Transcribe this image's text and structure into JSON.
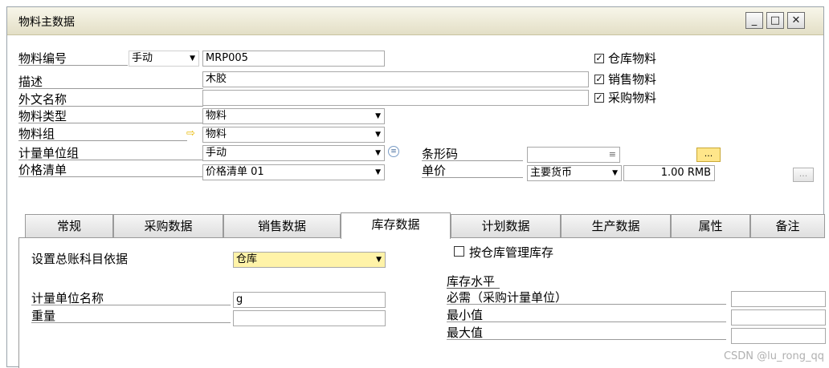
{
  "window": {
    "title": "物料主数据",
    "controls": {
      "minimize": "_",
      "maximize": "□",
      "close": "✕"
    }
  },
  "header": {
    "item_code_label": "物料编号",
    "item_code_mode": "手动",
    "item_code_value": "MRP005",
    "description_label": "描述",
    "description_value": "木胶",
    "foreign_name_label": "外文名称",
    "foreign_name_value": "",
    "item_type_label": "物料类型",
    "item_type_value": "物料",
    "item_group_label": "物料组",
    "item_group_value": "物料",
    "uom_group_label": "计量单位组",
    "uom_group_value": "手动",
    "price_list_label": "价格清单",
    "price_list_value": "价格清单 01",
    "barcode_label": "条形码",
    "barcode_value": "",
    "barcode_button": "...",
    "unit_price_label": "单价",
    "currency_value": "主要货币",
    "unit_price_value": "1.00 RMB",
    "price_more_button": "..."
  },
  "checkboxes": {
    "inventory_item": {
      "label": "仓库物料",
      "checked": true
    },
    "sales_item": {
      "label": "销售物料",
      "checked": true
    },
    "purchase_item": {
      "label": "采购物料",
      "checked": true
    }
  },
  "tabs": [
    {
      "label": "常规",
      "active": false
    },
    {
      "label": "采购数据",
      "active": false
    },
    {
      "label": "销售数据",
      "active": false
    },
    {
      "label": "库存数据",
      "active": true
    },
    {
      "label": "计划数据",
      "active": false
    },
    {
      "label": "生产数据",
      "active": false
    },
    {
      "label": "属性",
      "active": false
    },
    {
      "label": "备注",
      "active": false
    }
  ],
  "inventory_tab": {
    "gl_method_label": "设置总账科目依据",
    "gl_method_value": "仓库",
    "uom_name_label": "计量单位名称",
    "uom_name_value": "g",
    "weight_label": "重量",
    "weight_value": "",
    "manage_by_warehouse": {
      "label": "按仓库管理库存",
      "checked": false
    },
    "stock_level_label": "库存水平",
    "required_label": "必需（采购计量单位）",
    "minimum_label": "最小值",
    "maximum_label": "最大值"
  },
  "watermark": "CSDN @lu_rong_qq",
  "colors": {
    "title_bar": "#e3dfc6",
    "highlight_field": "#fff3a8",
    "link_arrow": "#e8b800"
  }
}
